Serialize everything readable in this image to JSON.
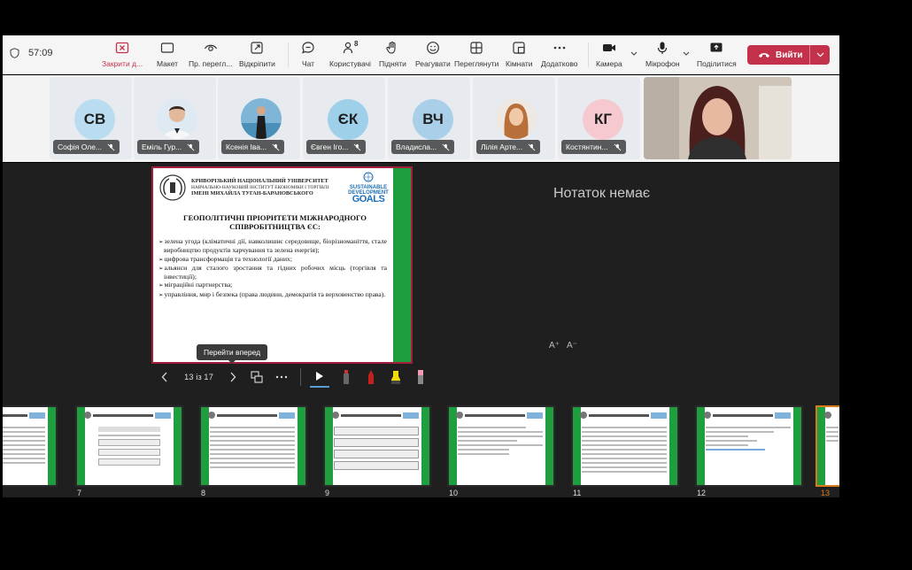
{
  "toolbar": {
    "timer": "57:09",
    "buttons": [
      {
        "label": "Закрити д...",
        "icon": "close-share-icon"
      },
      {
        "label": "Макет",
        "icon": "layout-icon"
      },
      {
        "label": "Пр. перегл...",
        "icon": "view-icon"
      },
      {
        "label": "Відкріпити",
        "icon": "unpin-icon"
      },
      {
        "label": "Чат",
        "icon": "chat-icon"
      },
      {
        "label": "Користувачі",
        "icon": "people-icon",
        "badge": "8"
      },
      {
        "label": "Підняти",
        "icon": "raise-hand-icon"
      },
      {
        "label": "Реагувати",
        "icon": "react-icon"
      },
      {
        "label": "Переглянути",
        "icon": "view-grid-icon"
      },
      {
        "label": "Кімнати",
        "icon": "rooms-icon"
      },
      {
        "label": "Додатково",
        "icon": "more-icon"
      },
      {
        "label": "Камера",
        "icon": "camera-icon"
      },
      {
        "label": "Мікрофон",
        "icon": "mic-icon"
      },
      {
        "label": "Поділитися",
        "icon": "share-icon"
      }
    ],
    "leave_label": "Вийти",
    "accent_color": "#c4314b"
  },
  "participants": [
    {
      "initials": "СВ",
      "name": "Софія Оле...",
      "color": "#b9dcf0"
    },
    {
      "initials": "",
      "name": "Еміль Гур...",
      "color": "#dfe9f2"
    },
    {
      "initials": "",
      "name": "Ксенія Іва...",
      "color": "#e3ecf2"
    },
    {
      "initials": "ЄК",
      "name": "Євген Іго...",
      "color": "#9fd0ea"
    },
    {
      "initials": "ВЧ",
      "name": "Владисла...",
      "color": "#aacfe8"
    },
    {
      "initials": "",
      "name": "Лілія Арте...",
      "color": "#efe8e2"
    },
    {
      "initials": "КГ",
      "name": "Костянтин...",
      "color": "#f6c9d0"
    }
  ],
  "slide": {
    "university": "КРИВОРІЗЬКИЙ НАЦІОНАЛЬНИЙ УНІВЕРСИТЕТ",
    "institute_line1": "НАВЧАЛЬНО-НАУКОВИЙ ІНСТИТУТ ЕКОНОМІКИ І ТОРГІВЛІ",
    "institute_line2": "ІМЕНІ МИХАЙЛА ТУГАН-БАРАНОВСЬКОГО",
    "sdg_line1": "SUSTAINABLE",
    "sdg_line2": "DEVELOPMENT",
    "sdg_goals": "GOALS",
    "title": "ГЕОПОЛІТИЧНІ ПРІОРИТЕТИ МІЖНАРОДНОГО СПІВРОБІТНИЦТВА ЄС:",
    "items": [
      "зелена угода (кліматичні дії, навколишнє середовище, біорізноманіття, стале виробництво продуктів харчування та зелена енергія);",
      "цифрова трансформація та технології даних;",
      "альянси для сталого зростання та гідних робочих місць (торгівля та інвестиції);",
      "міграційні партнерства;",
      "управління, мир і безпека (права людини, демократія та верховенство права)."
    ]
  },
  "presenter": {
    "tooltip": "Перейти вперед",
    "counter": "13 із 17",
    "notes_empty": "Нотаток немає",
    "font_increase": "A⁺",
    "font_decrease": "A⁻"
  },
  "thumbnails": {
    "numbers": [
      "7",
      "8",
      "9",
      "10",
      "11",
      "12",
      "13"
    ],
    "active": "13"
  }
}
